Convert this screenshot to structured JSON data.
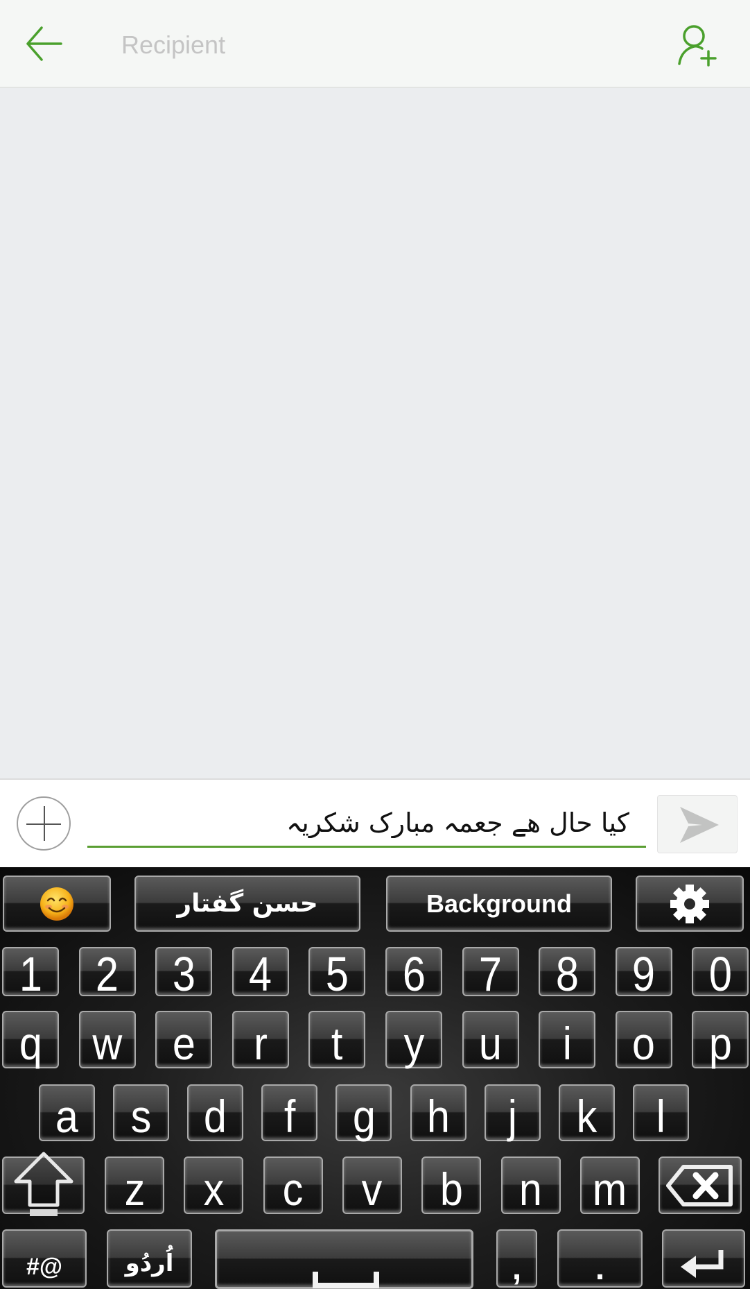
{
  "header": {
    "back_icon": "arrow-left-icon",
    "recipient_placeholder": "Recipient",
    "add_contact_icon": "person-add-icon"
  },
  "compose": {
    "attach_icon": "plus-circle-icon",
    "message_text": "کیا حال ھے جعمہ مبارک شکریہ",
    "send_icon": "send-icon"
  },
  "colors": {
    "accent": "#5a9e32",
    "header_bg": "#f5f7f5",
    "messages_bg": "#ebedef",
    "keyboard_bg": "#0a0a0a",
    "send_icon": "#c2c3c2"
  },
  "keyboard": {
    "toolbar": {
      "emoji_icon": "smiley-face-icon",
      "phrase_label": "حسن گفتار",
      "background_label": "Background",
      "settings_icon": "gear-icon"
    },
    "number_row": [
      "1",
      "2",
      "3",
      "4",
      "5",
      "6",
      "7",
      "8",
      "9",
      "0"
    ],
    "row1": [
      "q",
      "w",
      "e",
      "r",
      "t",
      "y",
      "u",
      "i",
      "o",
      "p"
    ],
    "row2": [
      "a",
      "s",
      "d",
      "f",
      "g",
      "h",
      "j",
      "k",
      "l"
    ],
    "row3": [
      "z",
      "x",
      "c",
      "v",
      "b",
      "n",
      "m"
    ],
    "shift_icon": "shift-arrow-icon",
    "backspace_icon": "backspace-icon",
    "symbols_label": "#@",
    "language_label": "اُردُو",
    "space_icon": "space-bar-icon",
    "comma_label": ",",
    "period_label": ".",
    "enter_icon": "enter-icon"
  }
}
